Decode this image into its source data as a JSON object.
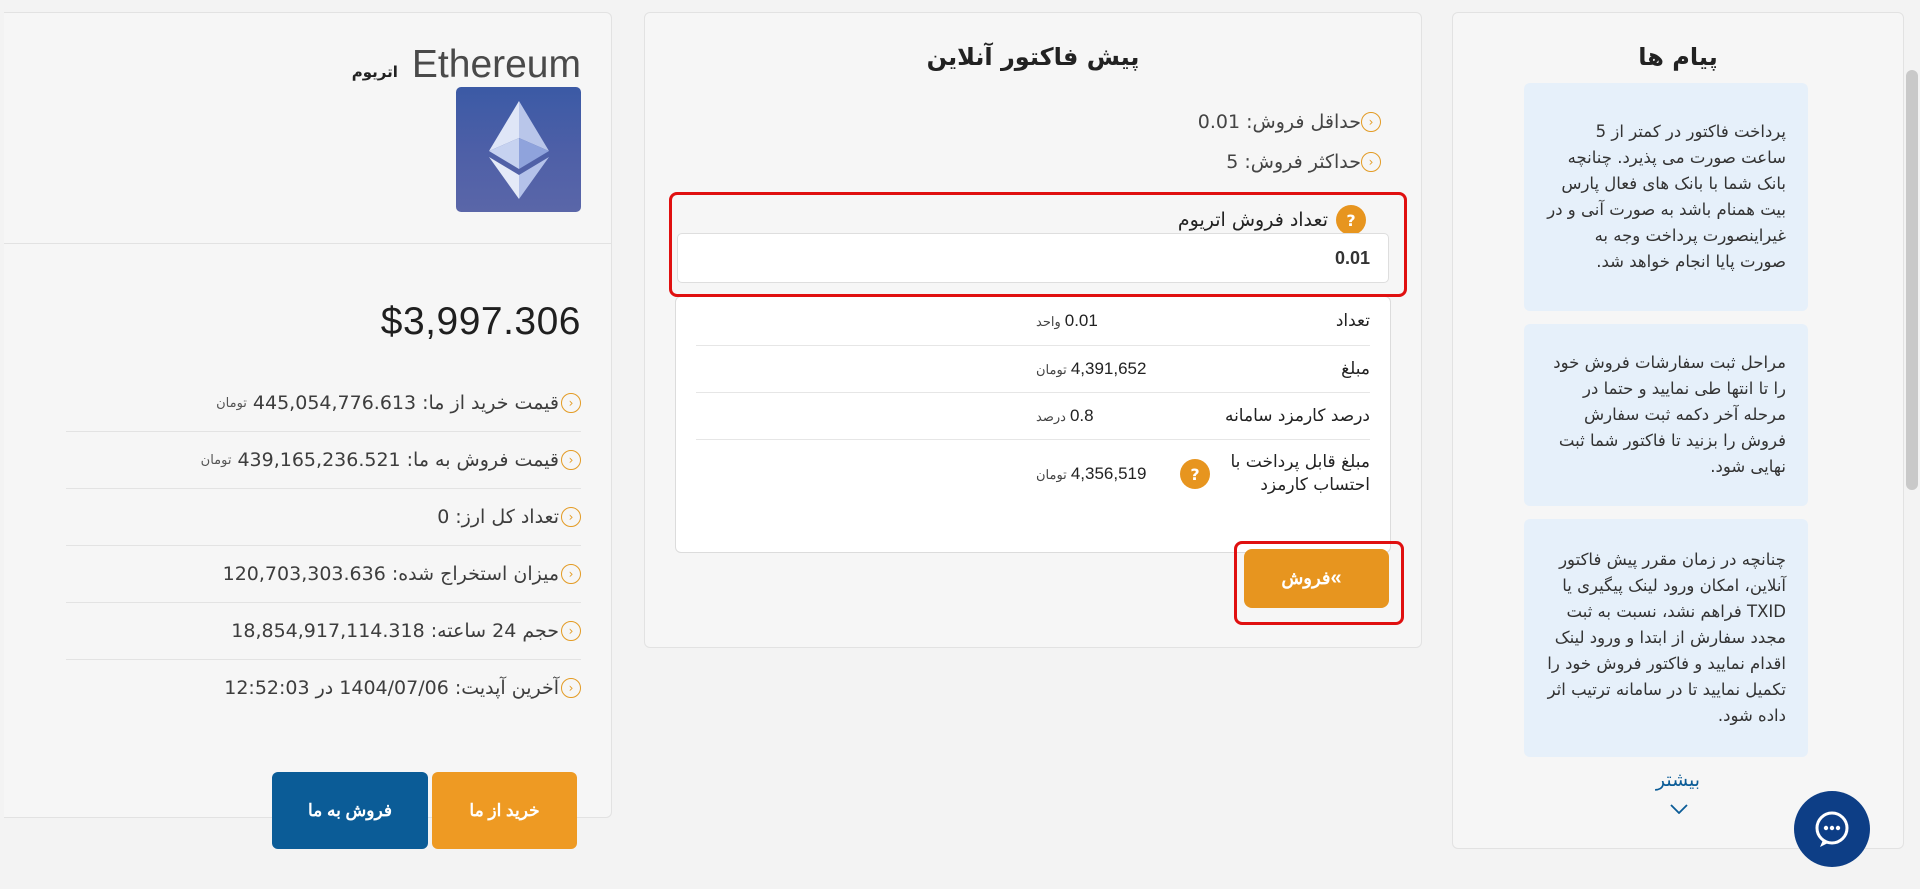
{
  "coin": {
    "name_en": "Ethereum",
    "name_fa": "اتریوم",
    "price_usd": "$3,997.306",
    "info": [
      {
        "label": "قیمت خرید از ما:",
        "value": "445,054,776.613",
        "unit": "تومان"
      },
      {
        "label": "قیمت فروش به ما:",
        "value": "439,165,236.521",
        "unit": "تومان"
      },
      {
        "label": "تعداد کل ارز:",
        "value": "0",
        "unit": ""
      },
      {
        "label": "میزان استخراج شده:",
        "value": "120,703,303.636",
        "unit": ""
      },
      {
        "label": "حجم 24 ساعته:",
        "value": "18,854,917,114.318",
        "unit": ""
      },
      {
        "label": "آخرین آپدیت:",
        "value": "1404/07/06 در 12:52:03",
        "unit": ""
      }
    ],
    "buy_button": "خرید از ما",
    "sell_to_us_button": "فروش به ما"
  },
  "invoice": {
    "title": "پیش فاکتور آنلاین",
    "min_sell": "حداقل فروش: 0.01",
    "max_sell": "حداکثر فروش: 5",
    "qty_label": "تعداد فروش اتریوم",
    "qty_value": "0.01",
    "help_glyph": "?",
    "summary": [
      {
        "label": "تعداد",
        "value": "0.01",
        "unit": "واحد"
      },
      {
        "label": "مبلغ",
        "value": "4,391,652",
        "unit": "تومان"
      },
      {
        "label": "درصد کارمزد سامانه",
        "value": "0.8",
        "unit": "درصد"
      },
      {
        "label": "مبلغ قابل پرداخت با احتساب کارمزد",
        "value": "4,356,519",
        "unit": "تومان"
      }
    ],
    "sell_button": "فروش"
  },
  "messages": {
    "title": "پیام ها",
    "items": [
      "پرداخت فاکتور در کمتر از 5 ساعت صورت می پذیرد. چنانچه بانک شما با بانک های فعال پارس بیت همنام باشد به صورت آنی و در غیراینصورت پرداخت وجه به صورت پایا انجام خواهد شد.",
      "مراحل ثبت سفارشات فروش خود را تا انتها طی نمایید و حتما در مرحله آخر دکمه ثبت سفارش فروش را بزنید تا فاکتور شما ثبت نهایی شود.",
      "چنانچه در زمان مقرر پیش فاکتور آنلاین، امکان ورود لینک پیگیری یا TXID فراهم نشد، نسبت به ثبت مجدد سفارش از ابتدا و ورود لینک اقدام نمایید و فاکتور فروش خود را تکمیل نمایید تا در سامانه ترتیب اثر داده شود."
    ],
    "more": "بیشتر"
  },
  "colors": {
    "accent": "#e7951f",
    "primary": "#0b5c97",
    "highlight": "#e01010",
    "message_bg": "#e6f0fa"
  },
  "icons": [
    "ethereum-logo-icon",
    "chevron-left-circle-icon",
    "question-icon",
    "double-chevron-icon",
    "chevron-down-icon",
    "chat-icon"
  ]
}
